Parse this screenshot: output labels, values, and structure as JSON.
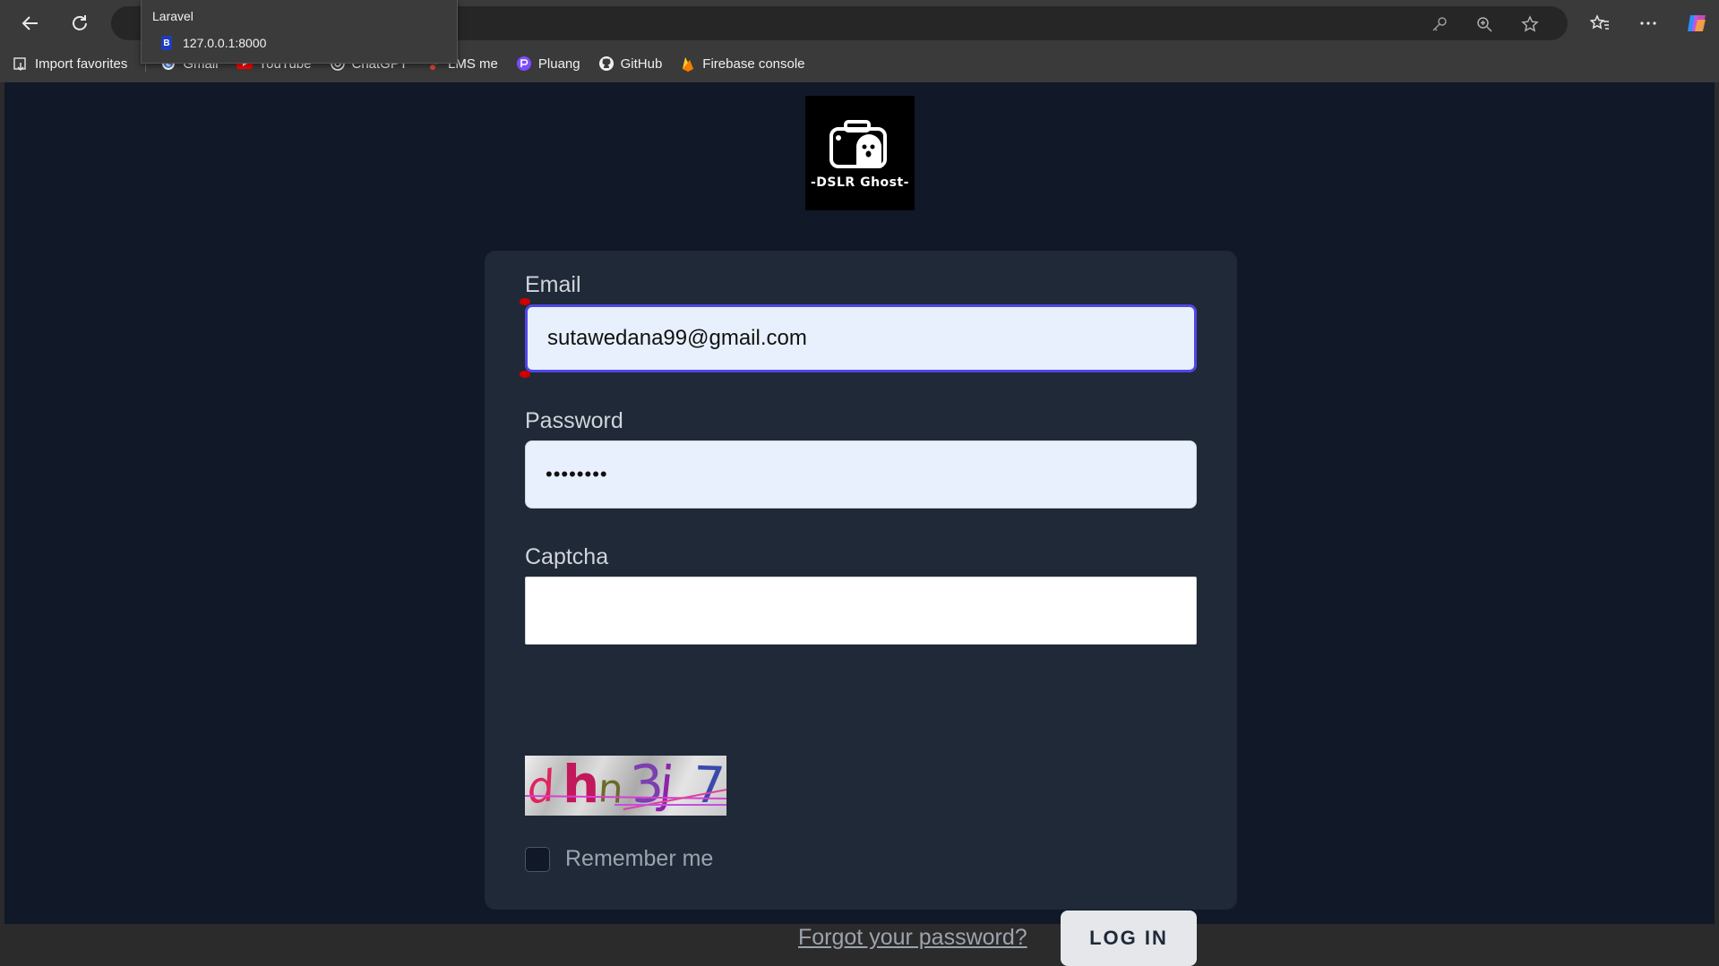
{
  "browser": {
    "tooltip": {
      "title": "Laravel",
      "url": "127.0.0.1:8000"
    },
    "bookmarks": [
      {
        "label": "Import favorites",
        "icon": "import-icon"
      },
      {
        "label": "Gmail",
        "icon": "google-icon"
      },
      {
        "label": "YouTube",
        "icon": "youtube-icon"
      },
      {
        "label": "ChatGPT",
        "icon": "chatgpt-icon"
      },
      {
        "label": "LMS me",
        "icon": "lms-icon"
      },
      {
        "label": "Pluang",
        "icon": "pluang-icon"
      },
      {
        "label": "GitHub",
        "icon": "github-icon"
      },
      {
        "label": "Firebase console",
        "icon": "firebase-icon"
      }
    ]
  },
  "logo": {
    "text": "-DSLR Ghost-"
  },
  "form": {
    "email_label": "Email",
    "email_value": "sutawedana99@gmail.com",
    "password_label": "Password",
    "password_value": "••••••••",
    "captcha_label": "Captcha",
    "captcha_value": "",
    "captcha_chars": [
      {
        "char": "d",
        "color": "#e0245e"
      },
      {
        "char": "h",
        "color": "#c2185b"
      },
      {
        "char": "n",
        "color": "#6b6b2a"
      },
      {
        "char": "3",
        "color": "#7b3fb0"
      },
      {
        "char": "j",
        "color": "#8e24aa"
      },
      {
        "char": "7",
        "color": "#3949ab"
      }
    ],
    "remember_label": "Remember me",
    "forgot_label": "Forgot your password?",
    "login_label": "LOG IN"
  },
  "colors": {
    "page_bg": "#111827",
    "card_bg": "#1f2937",
    "input_bg": "#e8f0fe",
    "focus_border": "#4f46e5"
  }
}
